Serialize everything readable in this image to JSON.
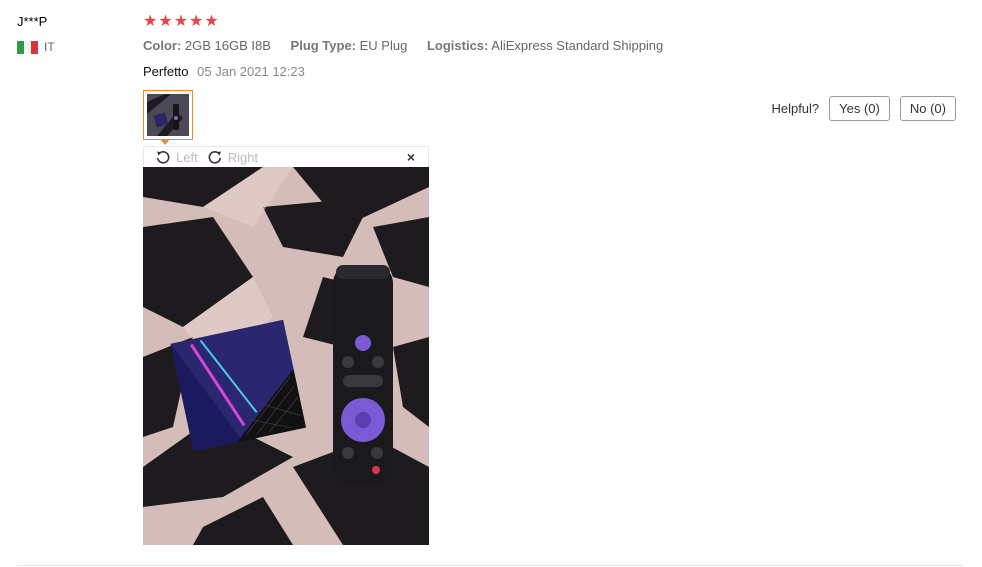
{
  "reviewer": {
    "name": "J***P",
    "country_code": "IT"
  },
  "rating": {
    "stars": 5,
    "max": 5,
    "star_glyph": "★",
    "color": "#e5454d"
  },
  "attributes": [
    {
      "key": "Color:",
      "value": "2GB 16GB I8B"
    },
    {
      "key": "Plug Type:",
      "value": "EU Plug"
    },
    {
      "key": "Logistics:",
      "value": "AliExpress Standard Shipping"
    }
  ],
  "review": {
    "text": "Perfetto",
    "date": "05 Jan 2021 12:23"
  },
  "helpful": {
    "label": "Helpful?",
    "yes": "Yes (0)",
    "no": "No (0)"
  },
  "viewer": {
    "rotate_left": "Left",
    "rotate_right": "Right",
    "close": "×"
  },
  "colors": {
    "accent": "#f08a24",
    "star": "#e5454d"
  }
}
